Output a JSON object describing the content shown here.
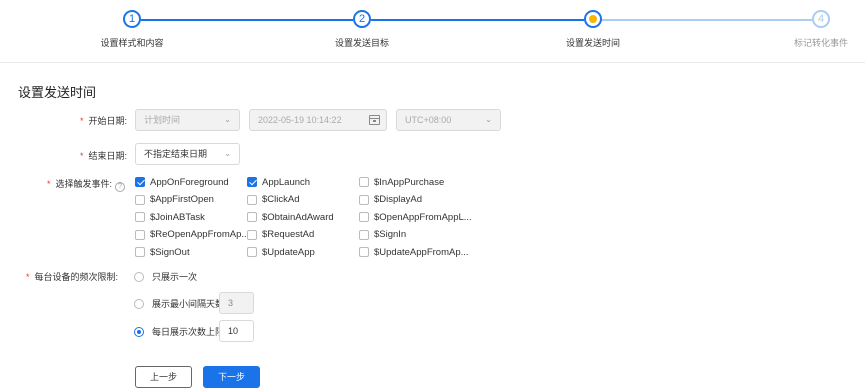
{
  "stepper": {
    "steps": [
      {
        "number": "1",
        "label": "设置样式和内容",
        "status": "done"
      },
      {
        "number": "2",
        "label": "设置发送目标",
        "status": "done"
      },
      {
        "number": "3",
        "label": "设置发送时间",
        "status": "current"
      },
      {
        "number": "4",
        "label": "标记转化事件",
        "status": "todo"
      }
    ]
  },
  "page": {
    "title": "设置发送时间"
  },
  "start_date": {
    "required_mark": "*",
    "label": "开始日期:",
    "type_value": "计划时间",
    "datetime_value": "2022-05-19 10:14:22",
    "timezone_value": "UTC+08:00"
  },
  "end_date": {
    "required_mark": "*",
    "label": "结束日期:",
    "value": "不指定结束日期"
  },
  "trigger_events": {
    "required_mark": "*",
    "label": "选择触发事件:",
    "help_icon": "?",
    "items": [
      {
        "label": "AppOnForeground",
        "checked": true
      },
      {
        "label": "AppLaunch",
        "checked": true
      },
      {
        "label": "$InAppPurchase",
        "checked": false
      },
      {
        "label": "$AppFirstOpen",
        "checked": false
      },
      {
        "label": "$ClickAd",
        "checked": false
      },
      {
        "label": "$DisplayAd",
        "checked": false
      },
      {
        "label": "$JoinABTask",
        "checked": false
      },
      {
        "label": "$ObtainAdAward",
        "checked": false
      },
      {
        "label": "$OpenAppFromAppL...",
        "checked": false
      },
      {
        "label": "$ReOpenAppFromAp...",
        "checked": false
      },
      {
        "label": "$RequestAd",
        "checked": false
      },
      {
        "label": "$SignIn",
        "checked": false
      },
      {
        "label": "$SignOut",
        "checked": false
      },
      {
        "label": "$UpdateApp",
        "checked": false
      },
      {
        "label": "$UpdateAppFromAp...",
        "checked": false
      }
    ]
  },
  "frequency": {
    "required_mark": "*",
    "label": "每台设备的频次限制:",
    "options": [
      {
        "label": "只展示一次",
        "selected": false
      },
      {
        "label": "展示最小间隔天数",
        "selected": false,
        "value": "3"
      },
      {
        "label": "每日展示次数上限",
        "selected": true,
        "value": "10"
      }
    ]
  },
  "actions": {
    "prev_label": "上一步",
    "next_label": "下一步"
  },
  "colors": {
    "primary": "#1a73e8",
    "current_step_dot": "#f7b500",
    "required": "#e53935"
  }
}
